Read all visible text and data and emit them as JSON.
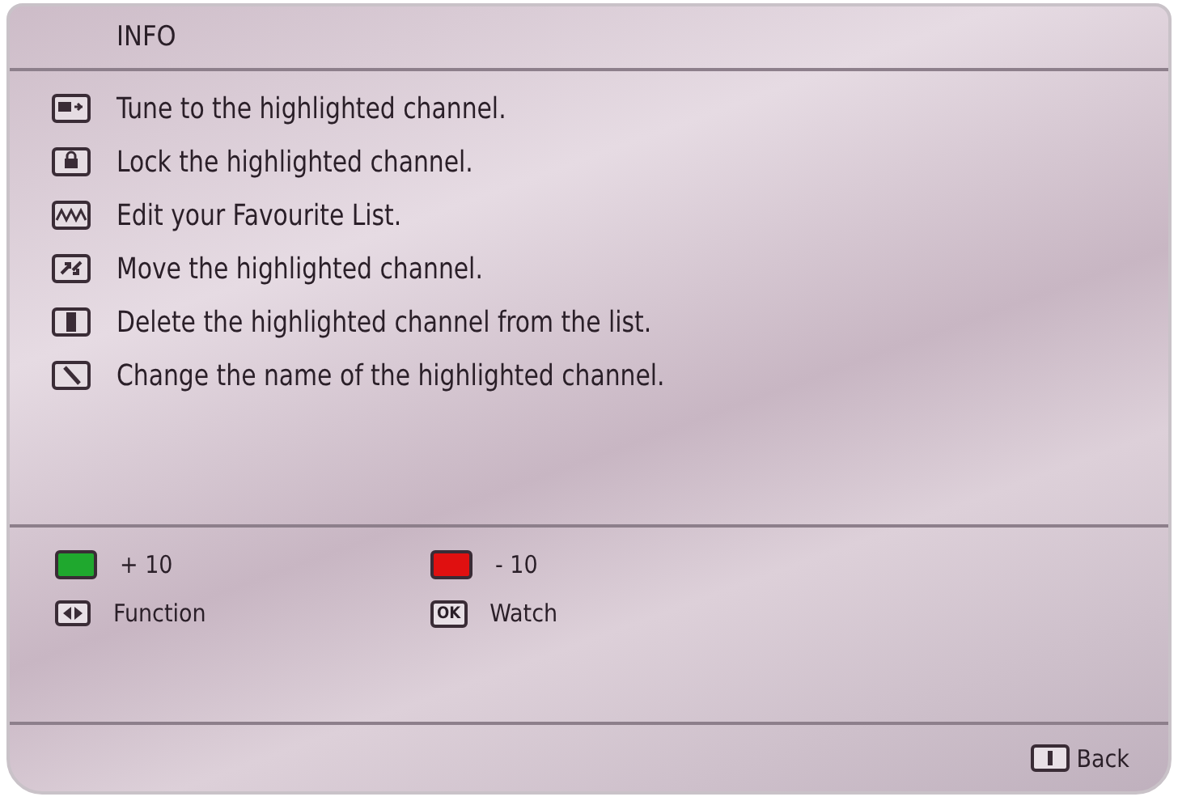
{
  "title": "INFO",
  "actions": [
    {
      "text": "Tune to the highlighted channel."
    },
    {
      "text": "Lock the highlighted channel."
    },
    {
      "text": "Edit your Favourite List."
    },
    {
      "text": "Move the highlighted channel."
    },
    {
      "text": "Delete the highlighted channel from the list."
    },
    {
      "text": "Change the name of the highlighted channel."
    }
  ],
  "legend": [
    {
      "kind": "color",
      "color": "#1fa82e",
      "text": "+ 10"
    },
    {
      "kind": "color",
      "color": "#e01010",
      "text": "- 10"
    },
    {
      "kind": "arrows",
      "text": "Function"
    },
    {
      "kind": "label",
      "key": "OK",
      "text": "Watch"
    }
  ],
  "footer": {
    "text": "Back"
  }
}
